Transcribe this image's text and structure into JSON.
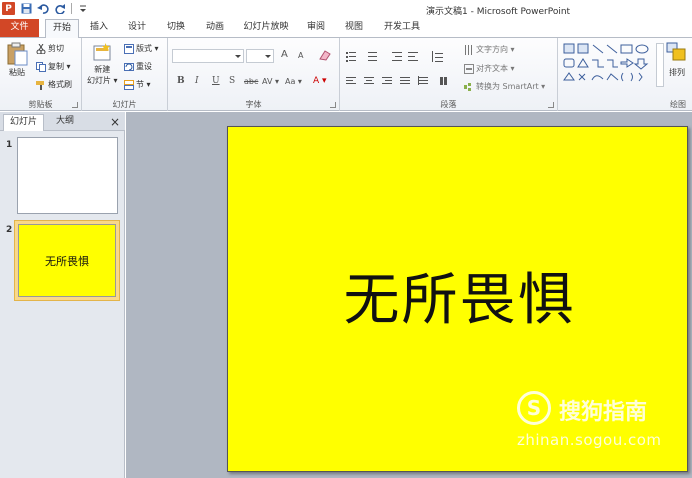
{
  "window": {
    "title": "演示文稿1 - Microsoft PowerPoint",
    "app_logo": "P"
  },
  "ribbon_tabs": [
    {
      "label": "文件"
    },
    {
      "label": "开始"
    },
    {
      "label": "插入"
    },
    {
      "label": "设计"
    },
    {
      "label": "切换"
    },
    {
      "label": "动画"
    },
    {
      "label": "幻灯片放映"
    },
    {
      "label": "审阅"
    },
    {
      "label": "视图"
    },
    {
      "label": "开发工具"
    }
  ],
  "groups": {
    "clipboard": {
      "label": "剪贴板",
      "paste": "粘贴",
      "cut": "剪切",
      "copy": "复制 ▾",
      "format_painter": "格式刷"
    },
    "slides": {
      "label": "幻灯片",
      "new_slide_1": "新建",
      "new_slide_2": "幻灯片 ▾",
      "layout": "版式 ▾",
      "reset": "重设",
      "section": "节 ▾"
    },
    "font": {
      "label": "字体",
      "bold": "B",
      "italic": "I",
      "underline": "U",
      "strike": "S",
      "abc": "abc",
      "spacing": "AV ▾",
      "case": "Aa ▾",
      "grow": "A",
      "shrink": "A",
      "color": "A ▾"
    },
    "paragraph": {
      "label": "段落",
      "text_direction": "文字方向 ▾",
      "align_text": "对齐文本 ▾",
      "convert_smartart": "转换为 SmartArt ▾"
    },
    "drawing": {
      "label": "绘图",
      "arrange": "排列"
    }
  },
  "pane": {
    "tab_slides": "幻灯片",
    "tab_outline": "大纲",
    "close": "×",
    "slides": [
      {
        "number": "1",
        "text": ""
      },
      {
        "number": "2",
        "text": "无所畏惧"
      }
    ]
  },
  "slide": {
    "text": "无所畏惧",
    "background": "#ffff00"
  },
  "watermark": {
    "logo": "S",
    "name": "搜狗指南",
    "url": "zhinan.sogou.com"
  },
  "colors": {
    "file_tab": "#d24726",
    "selected_thumb": "#f9d88a",
    "slide_bg": "#ffff00"
  }
}
